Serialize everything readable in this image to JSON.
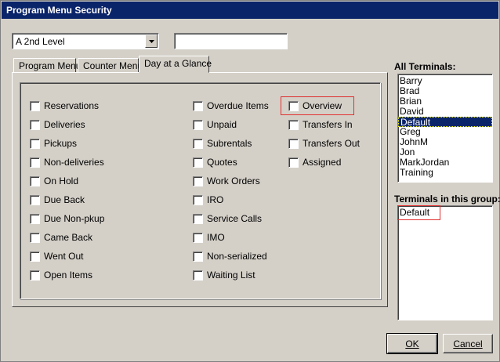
{
  "window": {
    "title": "Program Menu Security"
  },
  "level_select": {
    "value": "A 2nd Level"
  },
  "name_input": {
    "value": ""
  },
  "tabs": [
    {
      "label": "Program Menu"
    },
    {
      "label": "Counter Menu"
    },
    {
      "label": "Day at a Glance",
      "active": true
    }
  ],
  "checkboxes": {
    "col1": [
      "Reservations",
      "Deliveries",
      "Pickups",
      "Non-deliveries",
      "On Hold",
      "Due Back",
      "Due Non-pkup",
      "Came Back",
      "Went Out",
      "Open Items"
    ],
    "col2": [
      "Overdue Items",
      "Unpaid",
      "Subrentals",
      "Quotes",
      "Work Orders",
      "IRO",
      "Service Calls",
      "IMO",
      "Non-serialized",
      "Waiting List"
    ],
    "col3": [
      "Overview",
      "Transfers In",
      "Transfers Out",
      "Assigned"
    ]
  },
  "all_terminals": {
    "label": "All Terminals:",
    "items": [
      "Barry",
      "Brad",
      "Brian",
      "David",
      "Default",
      "Greg",
      "JohnM",
      "Jon",
      "MarkJordan",
      "Training"
    ],
    "selected": "Default"
  },
  "group_terminals": {
    "label": "Terminals in this group:",
    "items": [
      "Default"
    ]
  },
  "buttons": {
    "ok": "OK",
    "cancel": "Cancel"
  },
  "colors": {
    "title_bar": "#0a246a",
    "highlight_box": "#e03030",
    "face": "#d4d0c8"
  }
}
